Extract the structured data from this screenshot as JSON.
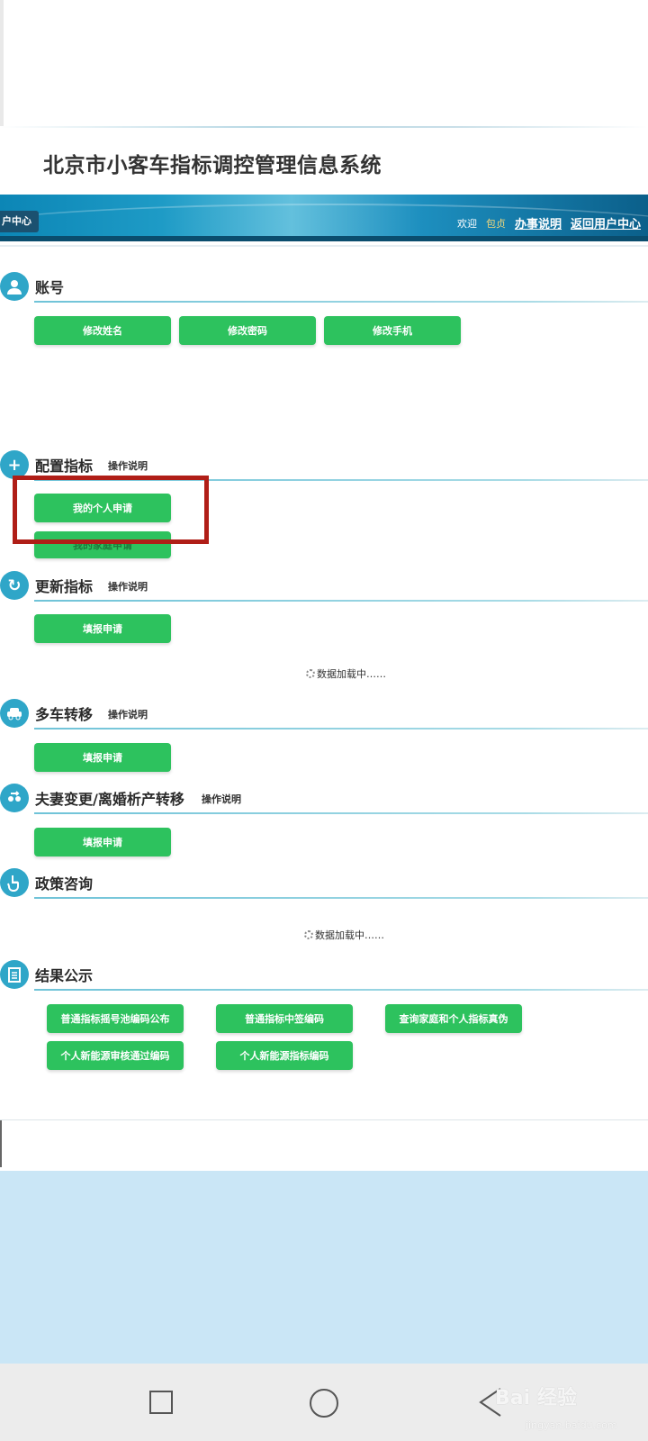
{
  "system_title": "北京市小客车指标调控管理信息系统",
  "banner": {
    "user_center_tab": "户中心",
    "welcome": "欢迎",
    "user_name": "包贞",
    "guide_link": "办事说明",
    "back_link": "返回用户中心"
  },
  "help_label": "操作说明",
  "loading_text": "数据加载中……",
  "sections": {
    "account": {
      "title": "账号",
      "buttons": [
        "修改姓名",
        "修改密码",
        "修改手机"
      ]
    },
    "allocation": {
      "title": "配置指标",
      "buttons": [
        "我的个人申请",
        "我的家庭申请"
      ]
    },
    "renewal": {
      "title": "更新指标",
      "buttons": [
        "填报申请"
      ]
    },
    "multi_car": {
      "title": "多车转移",
      "buttons": [
        "填报申请"
      ]
    },
    "spouse": {
      "title": "夫妻变更/离婚析产转移",
      "buttons": [
        "填报申请"
      ]
    },
    "policy": {
      "title": "政策咨询"
    },
    "results": {
      "title": "结果公示",
      "buttons": [
        "普通指标摇号池编码公布",
        "普通指标中签编码",
        "查询家庭和个人指标真伪",
        "个人新能源审核通过编码",
        "个人新能源指标编码"
      ]
    }
  },
  "watermark": {
    "brand": "Bai 经验",
    "url": "jingyan.baidu.com"
  }
}
